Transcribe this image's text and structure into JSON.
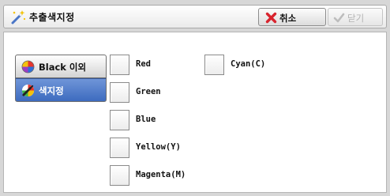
{
  "header": {
    "title": "추출색지정",
    "title_icon": "wand-icon",
    "cancel_label": "취소",
    "cancel_icon": "red-x-icon",
    "close_label": "닫기",
    "close_icon": "check-icon"
  },
  "tabs": [
    {
      "label": "Black 이외",
      "icon": "color-wheel-icon",
      "selected": false
    },
    {
      "label": "색지정",
      "icon": "eyedropper-icon",
      "selected": true
    }
  ],
  "colors": {
    "red": "Red",
    "green": "Green",
    "blue": "Blue",
    "yellow": "Yellow(Y)",
    "magenta": "Magenta(M)",
    "cyan": "Cyan(C)"
  },
  "accent": "#4a76c7",
  "cancel_x_color": "#d8242e"
}
